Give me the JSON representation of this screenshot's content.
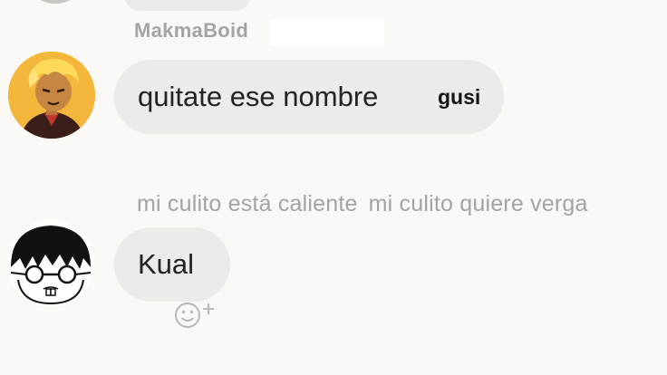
{
  "previous_message": {
    "sender_hint": ""
  },
  "message1": {
    "sender": "MakmaBoid",
    "text": "quitate ese nombre",
    "overlay_text": "gusi"
  },
  "message2": {
    "reply_header_parts": [
      "mi culito está caliente",
      "mi culito quiere verga"
    ],
    "text": "Kual",
    "reaction_button_icon": "smiley-add-reaction-icon"
  },
  "colors": {
    "background": "#fbf9f5",
    "bubble": "#eceaea",
    "sender_name": "#a6a4a2",
    "reply_text": "#a3a3a3",
    "message_text": "#232323",
    "avatar1_bg": "#f5b63c"
  }
}
